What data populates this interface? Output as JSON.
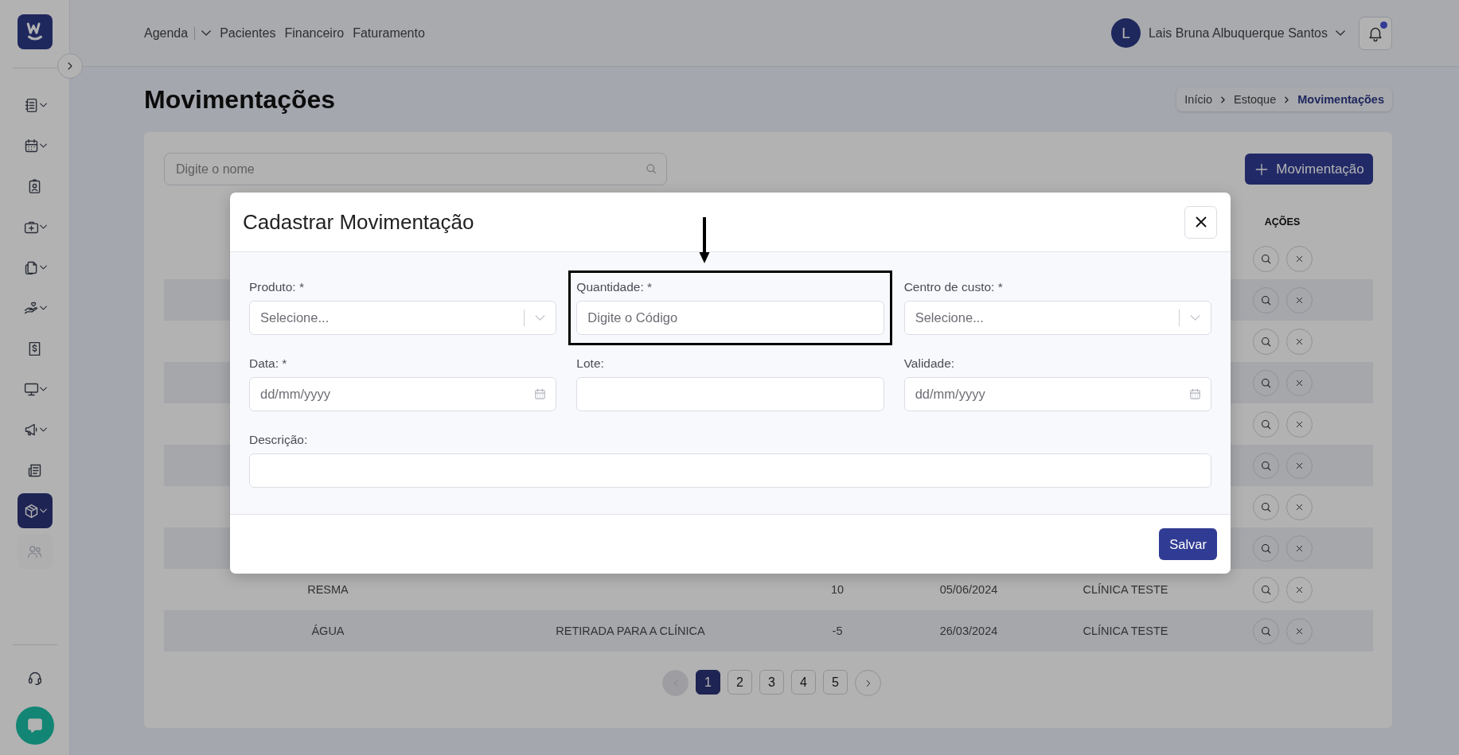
{
  "sidebar": {
    "items": [
      {
        "kind": "notebook",
        "has_caret": true,
        "selected": false,
        "disabled": false
      },
      {
        "kind": "calendar",
        "has_caret": true,
        "selected": false,
        "disabled": false
      },
      {
        "kind": "id-badge",
        "has_caret": false,
        "selected": false,
        "disabled": false
      },
      {
        "kind": "medical-bag",
        "has_caret": true,
        "selected": false,
        "disabled": false
      },
      {
        "kind": "files",
        "has_caret": true,
        "selected": false,
        "disabled": false
      },
      {
        "kind": "hand-heart",
        "has_caret": true,
        "selected": false,
        "disabled": false
      },
      {
        "kind": "receipt",
        "has_caret": false,
        "selected": false,
        "disabled": false
      },
      {
        "kind": "monitor",
        "has_caret": true,
        "selected": false,
        "disabled": false
      },
      {
        "kind": "megaphone",
        "has_caret": true,
        "selected": false,
        "disabled": false
      },
      {
        "kind": "newspaper",
        "has_caret": false,
        "selected": false,
        "disabled": false
      },
      {
        "kind": "box",
        "has_caret": true,
        "selected": true,
        "disabled": false
      },
      {
        "kind": "users",
        "has_caret": false,
        "selected": false,
        "disabled": true
      }
    ]
  },
  "topbar": {
    "nav": [
      {
        "label": "Agenda",
        "has_dropdown": true
      },
      {
        "label": "Pacientes",
        "has_dropdown": false
      },
      {
        "label": "Financeiro",
        "has_dropdown": false
      },
      {
        "label": "Faturamento",
        "has_dropdown": false
      }
    ],
    "user": {
      "initial": "L",
      "name": "Lais Bruna Albuquerque Santos"
    },
    "notifications": {
      "unread": true
    }
  },
  "page": {
    "title": "Movimentações",
    "breadcrumbs": [
      {
        "label": "Início",
        "current": false
      },
      {
        "label": "Estoque",
        "current": false
      },
      {
        "label": "Movimentações",
        "current": true
      }
    ]
  },
  "list": {
    "search": {
      "placeholder": "Digite o nome"
    },
    "add_button": "Movimentação",
    "table": {
      "actions_header": "AÇÕES",
      "rows": [
        {},
        {},
        {},
        {},
        {},
        {},
        {},
        {},
        {
          "column_1": "RESMA",
          "column_3": "10",
          "column_4": "05/06/2024",
          "column_5": "CLÍNICA TESTE"
        },
        {
          "column_1": "ÁGUA",
          "column_2": "RETIRADA PARA A CLÍNICA",
          "column_3": "-5",
          "column_4": "26/03/2024",
          "column_5": "CLÍNICA TESTE"
        }
      ]
    },
    "pagination": {
      "prev_disabled": true,
      "pages": [
        {
          "label": "1",
          "selected": true
        },
        {
          "label": "2",
          "selected": false
        },
        {
          "label": "3",
          "selected": false
        },
        {
          "label": "4",
          "selected": false
        },
        {
          "label": "5",
          "selected": false
        }
      ]
    }
  },
  "modal": {
    "title": "Cadastrar Movimentação",
    "fields": [
      {
        "kind": "select",
        "label": "Produto: *",
        "placeholder": "Selecione...",
        "highlighted": false,
        "wide": false
      },
      {
        "kind": "text",
        "label": "Quantidade: *",
        "placeholder": "Digite o Código",
        "highlighted": true,
        "wide": false
      },
      {
        "kind": "select",
        "label": "Centro de custo: *",
        "placeholder": "Selecione...",
        "highlighted": false,
        "wide": false
      },
      {
        "kind": "date",
        "label": "Data: *",
        "placeholder": "dd/mm/yyyy",
        "highlighted": false,
        "wide": false
      },
      {
        "kind": "text",
        "label": "Lote:",
        "highlighted": false,
        "wide": false
      },
      {
        "kind": "date",
        "label": "Validade:",
        "placeholder": "dd/mm/yyyy",
        "highlighted": false,
        "wide": false
      },
      {
        "kind": "text",
        "label": "Descrição:",
        "highlighted": false,
        "wide": true
      }
    ],
    "save_button": "Salvar"
  }
}
